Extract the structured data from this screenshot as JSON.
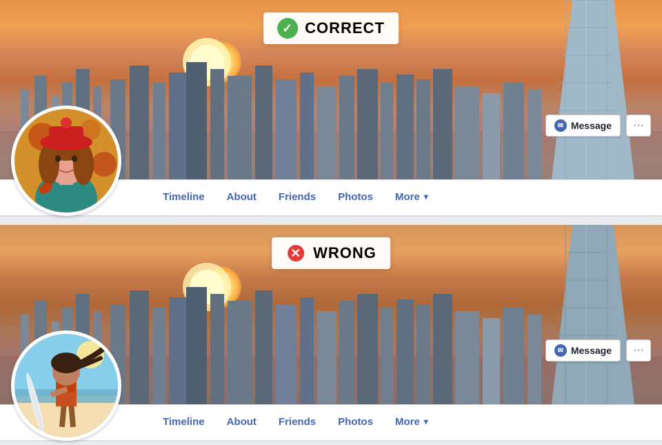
{
  "sections": [
    {
      "id": "correct",
      "label": "CORRECT",
      "label_type": "correct",
      "nav": {
        "tabs": [
          "Timeline",
          "About",
          "Friends",
          "Photos",
          "More"
        ],
        "message_btn": "Message",
        "dots": "···"
      }
    },
    {
      "id": "wrong",
      "label": "WRONG",
      "label_type": "wrong",
      "nav": {
        "tabs": [
          "Timeline",
          "About",
          "Friends",
          "Photos",
          "More"
        ],
        "message_btn": "Message",
        "dots": "···"
      }
    }
  ],
  "icons": {
    "check": "✓",
    "x": "✕",
    "messenger": "⚡",
    "chevron_down": "▾",
    "dots": "···"
  }
}
